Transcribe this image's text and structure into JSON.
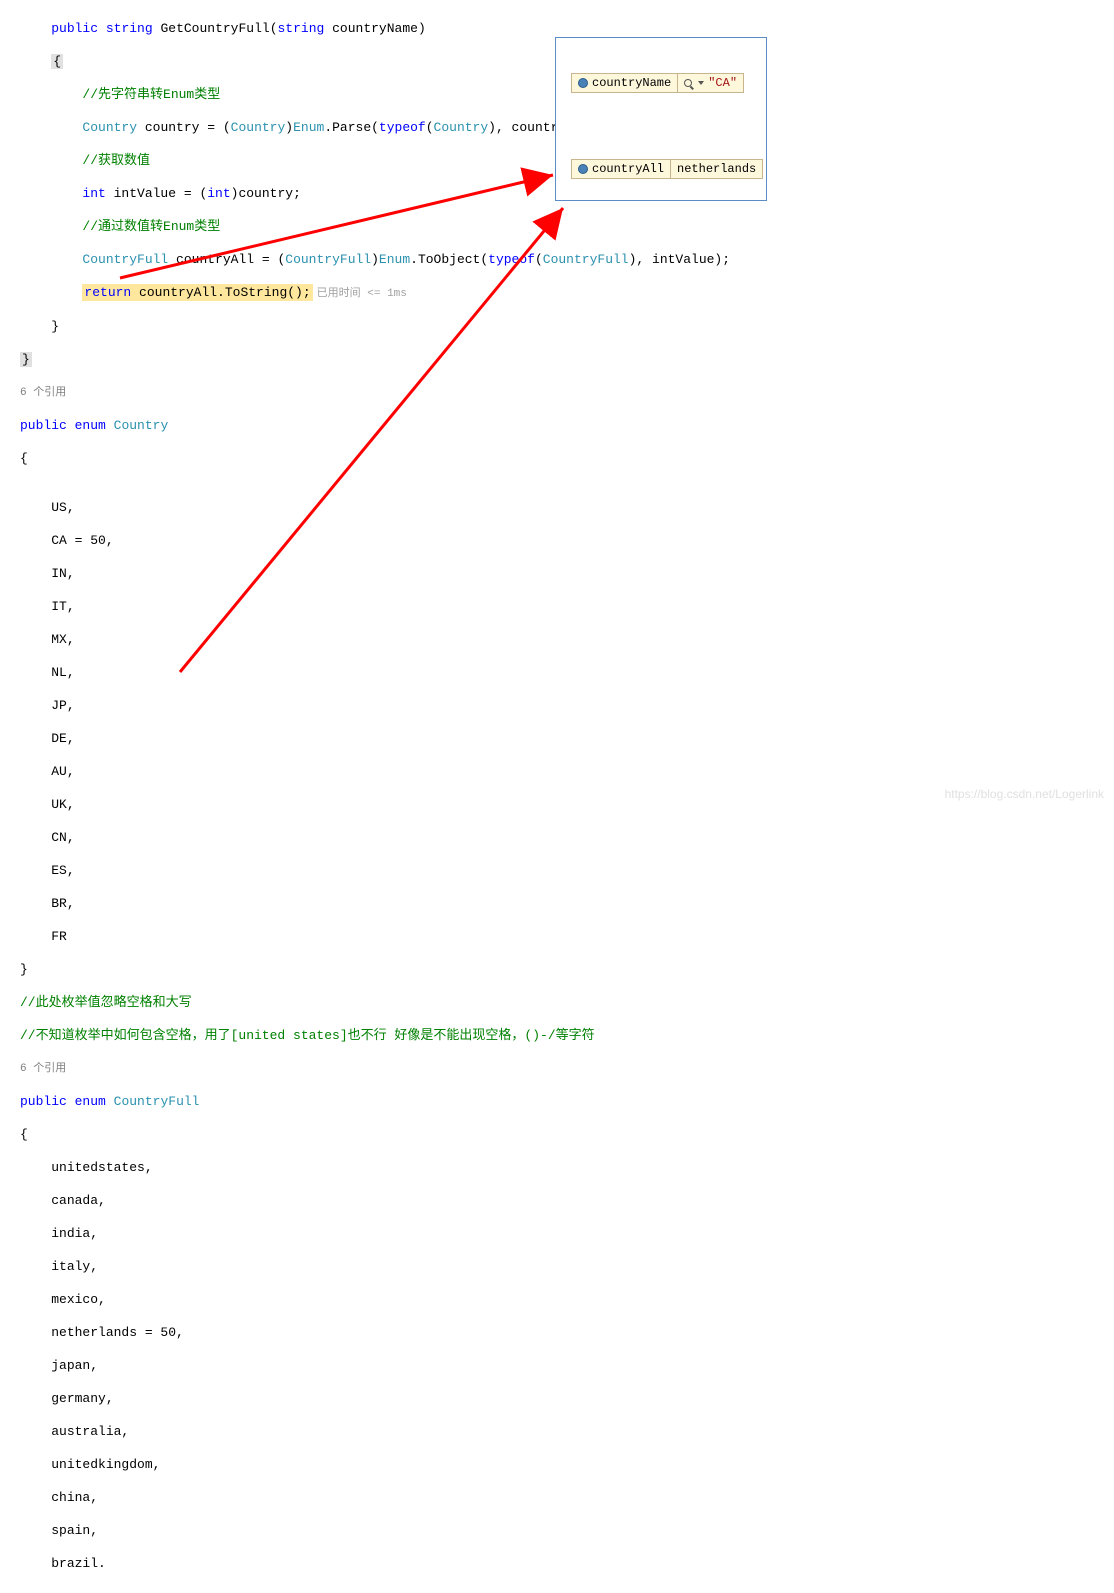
{
  "code": {
    "method_sig_prefix": "public",
    "method_ret": "string",
    "method_name": "GetCountryFull",
    "method_param_type": "string",
    "method_param_name": "countryName",
    "brace_open": "{",
    "brace_hl": "{",
    "comment1": "//先字符串转Enum类型",
    "line_country_decl": "Country",
    "line_country_var": "country = (",
    "line_country_cast": "Country",
    "line_country_rest": ")",
    "enum_class": "Enum",
    "parse_method": ".Parse(",
    "typeof_kw": "typeof",
    "country_type": "Country",
    "parse_end": "), countryName);",
    "comment2": "//获取数值",
    "int_kw": "int",
    "intvalue_decl": " intValue = (",
    "int_cast": "int",
    "intvalue_end": ")country;",
    "comment3": "//通过数值转Enum类型",
    "cf_type": "CountryFull",
    "cf_var": " countryAll = (",
    "cf_cast": "CountryFull",
    "cf_rest": ")",
    "toobj": ".ToObject(",
    "cf_type2": "CountryFull",
    "toobj_end": "), intValue);",
    "return_kw": "return",
    "return_expr": " countryAll.ToString();",
    "timing_label": "已用时间",
    "timing_value": "<= 1ms",
    "brace_close": "}",
    "brace_close_hl": "}",
    "codelens1": "6 个引用",
    "enum1_decl": "public",
    "enum_kw": "enum",
    "country_enum": "Country",
    "enum1_open": "{",
    "enum1_values": [
      "US,",
      "CA = 50,",
      "IN,",
      "IT,",
      "MX,",
      "NL,",
      "JP,",
      "DE,",
      "AU,",
      "UK,",
      "CN,",
      "ES,",
      "BR,",
      "FR"
    ],
    "enum1_close": "}",
    "comment4": "//此处枚举值忽略空格和大写",
    "comment5": "//不知道枚举中如何包含空格，用了[united states]也不行 好像是不能出现空格，()-/等字符",
    "codelens2": "6 个引用",
    "enum2_decl": "public",
    "cf_enum": "CountryFull",
    "enum2_open": "{",
    "enum2_values": [
      "unitedstates,",
      "canada,",
      "india,",
      "italy,",
      "mexico,",
      "netherlands = 50,",
      "japan,",
      "germany,",
      "australia,",
      "unitedkingdom,",
      "china,",
      "spain,",
      "brazil."
    ]
  },
  "debug": {
    "tip1_name": "countryName",
    "tip1_value": "\"CA\"",
    "tip2_name": "countryAll",
    "tip2_value": "netherlands"
  },
  "watermark": "https://blog.csdn.net/Logerlink"
}
